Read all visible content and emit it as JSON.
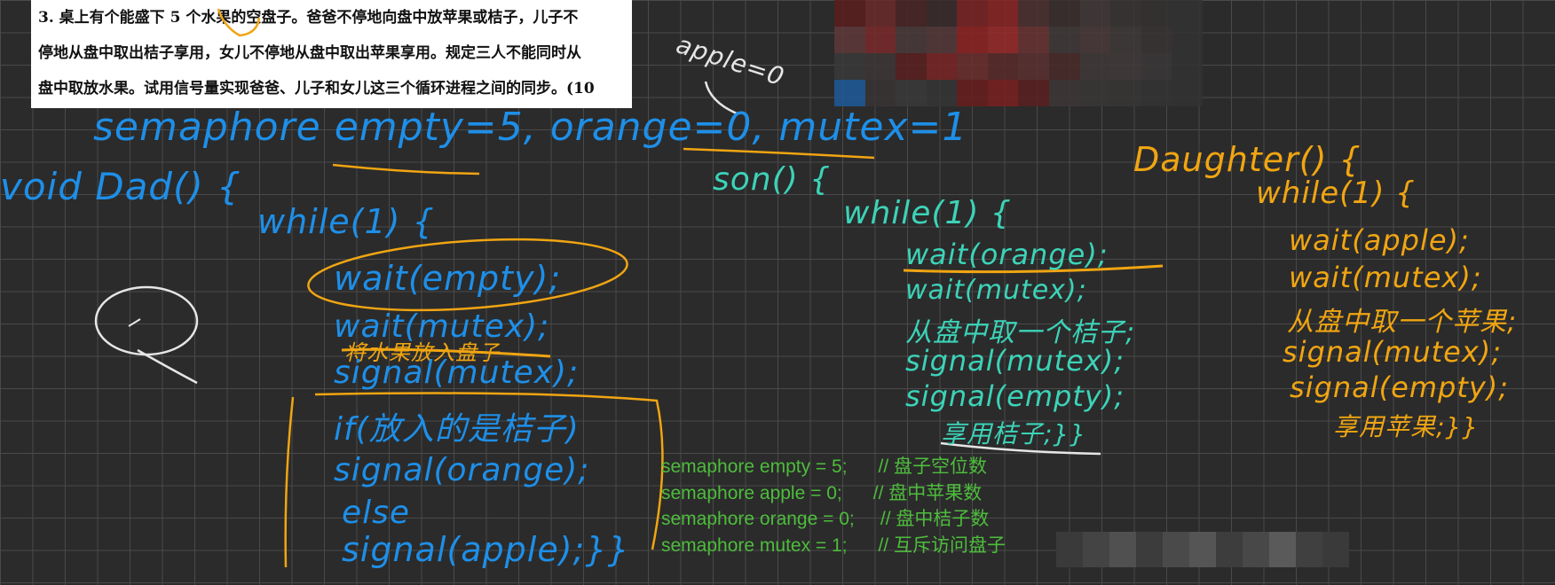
{
  "question": {
    "lines": [
      "3. 桌上有个能盛下 5 个水果的空盘子。爸爸不停地向盘中放苹果或桔子，儿子不",
      "停地从盘中取出桔子享用，女儿不停地从盘中取出苹果享用。规定三人不能同时从",
      "盘中取放水果。试用信号量实现爸爸、儿子和女儿这三个循环进程之间的同步。(10"
    ]
  },
  "annotations": {
    "apple_note": "apple=0",
    "declaration": "semaphore empty=5, orange=0, mutex=1"
  },
  "dad": {
    "header": "void Dad() {",
    "loop": "while(1) {",
    "lines": [
      "wait(empty);",
      "wait(mutex);",
      "将水果放入盘子",
      "signal(mutex);",
      "if(放入的是桔子)",
      "signal(orange);",
      "else",
      "signal(apple);}}"
    ]
  },
  "son": {
    "header": "son() {",
    "loop": "while(1) {",
    "lines": [
      "wait(orange);",
      "wait(mutex);",
      "从盘中取一个桔子;",
      "signal(mutex);",
      "signal(empty);",
      "享用桔子;}}"
    ]
  },
  "daughter": {
    "header": "Daughter() {",
    "loop": "while(1) {",
    "lines": [
      "wait(apple);",
      "wait(mutex);",
      "从盘中取一个苹果;",
      "signal(mutex);",
      "signal(empty);",
      "享用苹果;}}"
    ]
  },
  "typed_code": [
    "semaphore empty = 5;      // 盘子空位数",
    "semaphore apple = 0;      // 盘中苹果数",
    "semaphore orange = 0;     // 盘中桔子数",
    "semaphore mutex = 1;      // 互斥访问盘子"
  ],
  "colors": {
    "background": "#2b2b2b",
    "grid": "#4a4a4a",
    "ink_blue": "#1e8fe8",
    "ink_teal": "#3cd3b8",
    "ink_orange": "#f0a512",
    "typed_green": "#4dbd3c"
  }
}
